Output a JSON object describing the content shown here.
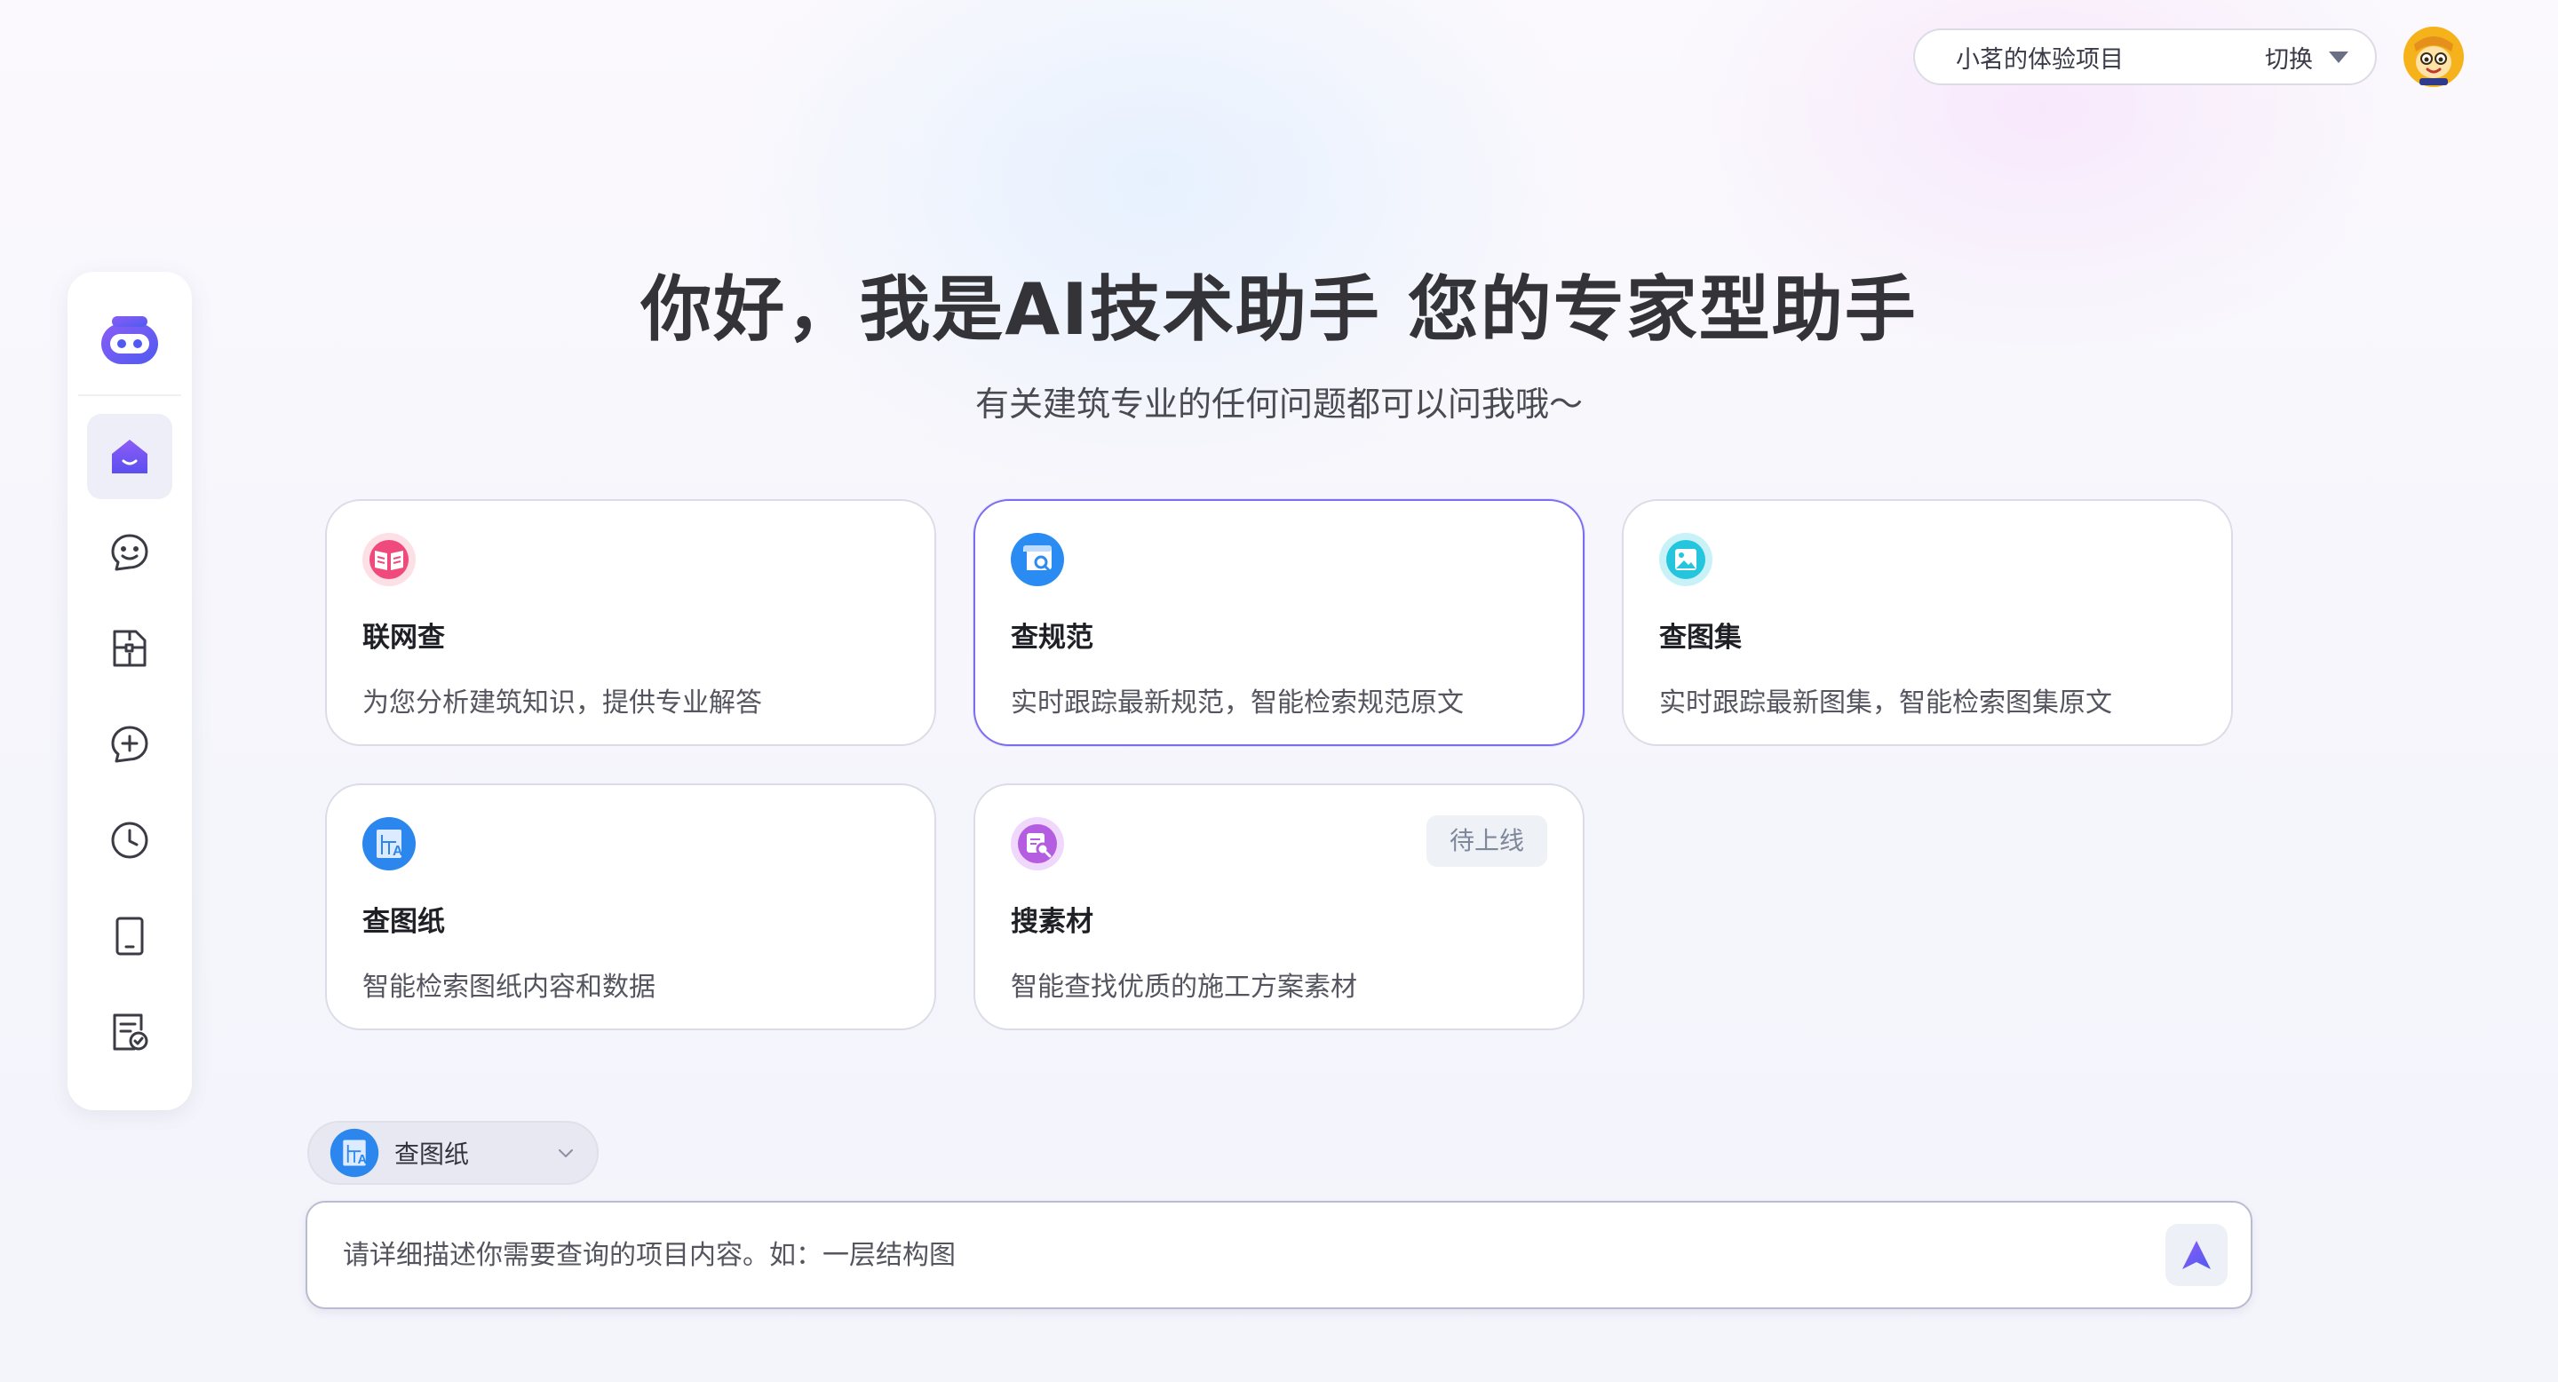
{
  "header": {
    "project_name": "小茗的体验项目",
    "switch_label": "切换"
  },
  "hero": {
    "title": "你好，我是AI技术助手 您的专家型助手",
    "subtitle": "有关建筑专业的任何问题都可以问我哦～"
  },
  "sidebar": {
    "items": [
      {
        "icon": "home-icon",
        "active": true
      },
      {
        "icon": "chat-face-icon",
        "active": false
      },
      {
        "icon": "floorplan-icon",
        "active": false
      },
      {
        "icon": "new-chat-icon",
        "active": false
      },
      {
        "icon": "clock-icon",
        "active": false
      },
      {
        "icon": "tablet-icon",
        "active": false
      },
      {
        "icon": "document-check-icon",
        "active": false
      }
    ]
  },
  "cards": [
    {
      "title": "联网查",
      "desc": "为您分析建筑知识，提供专业解答",
      "icon": "open-book-icon",
      "color": "#f0497b"
    },
    {
      "title": "查规范",
      "desc": "实时跟踪最新规范，智能检索规范原文",
      "icon": "spec-search-icon",
      "color": "#2a8cf2"
    },
    {
      "title": "查图集",
      "desc": "实时跟踪最新图集，智能检索图集原文",
      "icon": "image-album-icon",
      "color": "#25c6dd"
    },
    {
      "title": "查图纸",
      "desc": "智能检索图纸内容和数据",
      "icon": "blueprint-icon",
      "color": "#2b86ee"
    },
    {
      "title": "搜素材",
      "desc": "智能查找优质的施工方案素材",
      "icon": "material-search-icon",
      "color": "#b45de0",
      "badge": "待上线"
    }
  ],
  "composer": {
    "mode_label": "查图纸",
    "placeholder": "请详细描述你需要查询的项目内容。如：一层结构图"
  },
  "colors": {
    "accent": "#7b6df2",
    "send": "#6c5cf0"
  }
}
